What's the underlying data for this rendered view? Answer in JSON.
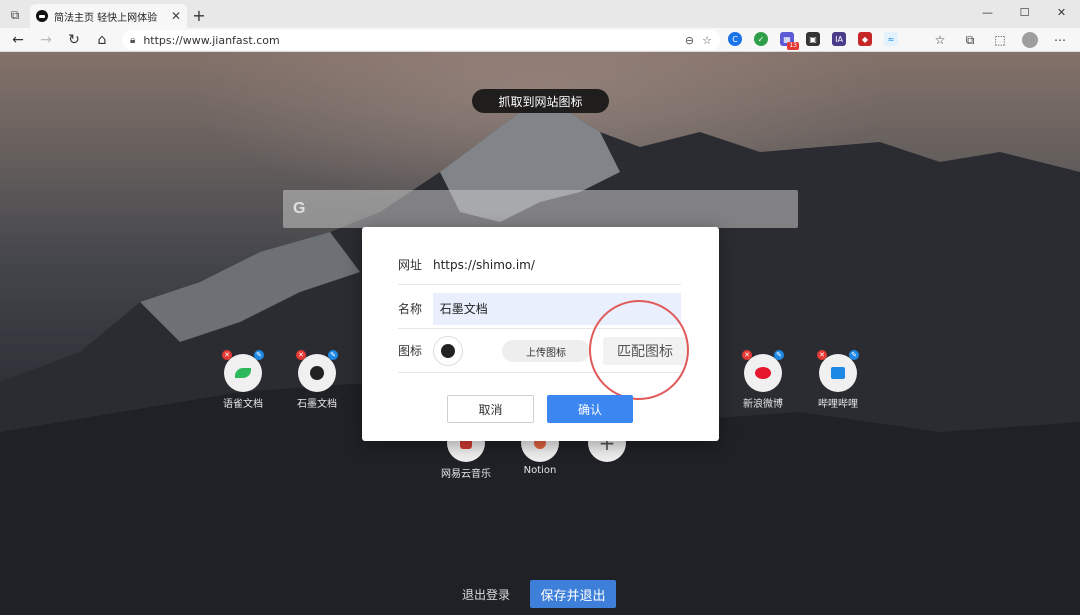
{
  "browser": {
    "tab_title": "简法主页 轻快上网体验",
    "url": "https://www.jianfast.com",
    "extension_badge": "13"
  },
  "page": {
    "capture_pill": "抓取到网站图标",
    "search_icon": "G",
    "sites": [
      {
        "label": "语雀文档",
        "icon": "yuque-icon",
        "color": "#2eb85c"
      },
      {
        "label": "石墨文档",
        "icon": "shimo-icon",
        "color": "#222222"
      },
      {
        "label": "新浪微博",
        "icon": "weibo-icon",
        "color": "#e6162d"
      },
      {
        "label": "哔哩哔哩",
        "icon": "bilibili-icon",
        "color": "#1e88e5"
      },
      {
        "label": "网易云音乐",
        "icon": "netease-music-icon",
        "color": "#d43c33"
      },
      {
        "label": "Notion",
        "icon": "notion-icon",
        "color": "#e2633f"
      }
    ],
    "add_icon": "+",
    "logout_label": "退出登录",
    "save_exit_label": "保存并退出"
  },
  "dialog": {
    "url_label": "网址",
    "url_value": "https://shimo.im/",
    "name_label": "名称",
    "name_value": "石墨文档",
    "icon_label": "图标",
    "upload_label": "上传图标",
    "match_label": "匹配图标",
    "cancel_label": "取消",
    "confirm_label": "确认"
  },
  "colors": {
    "primary": "#3b86f0",
    "highlight": "#e05a5a",
    "input_bg": "#e9effd"
  }
}
